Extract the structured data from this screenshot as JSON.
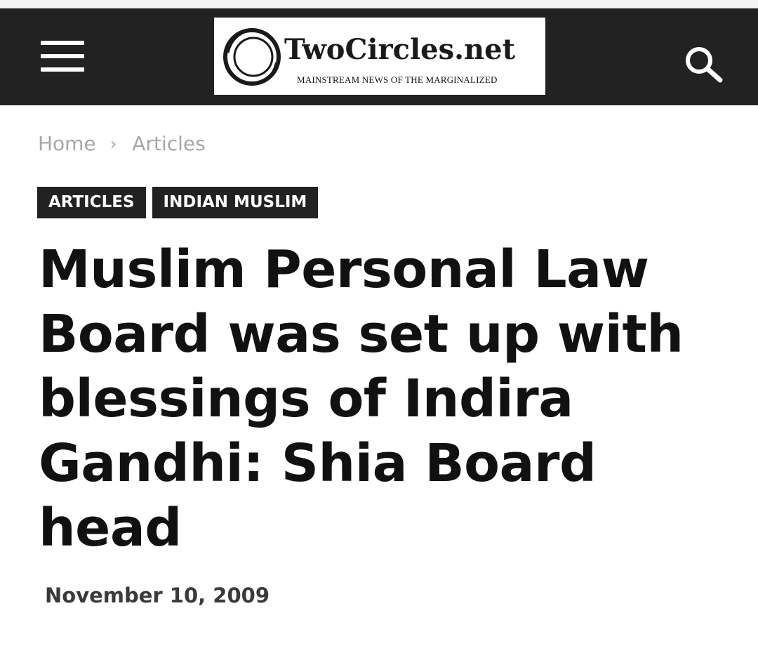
{
  "header": {
    "menu_icon": "hamburger-menu-icon",
    "search_icon": "search-icon",
    "background_color": "#222222"
  },
  "logo": {
    "title": "TwoCircles.net",
    "tagline": "MAINSTREAM NEWS OF THE MARGINALIZED"
  },
  "breadcrumb": {
    "items": [
      "Home",
      "Articles"
    ],
    "separator": "›"
  },
  "tags": [
    "ARTICLES",
    "INDIAN MUSLIM"
  ],
  "article": {
    "title": "Muslim Personal Law Board was set up with blessings of Indira Gandhi: Shia Board head",
    "date": "November 10, 2009"
  }
}
